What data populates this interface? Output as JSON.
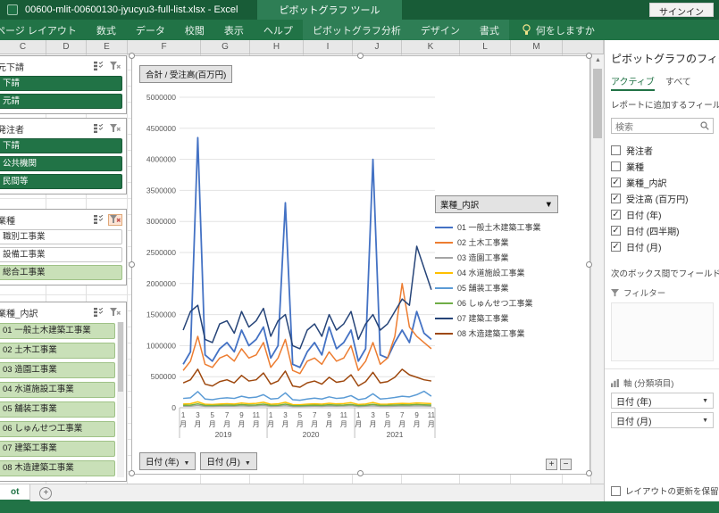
{
  "title_bar": {
    "filename": "00600-mlit-00600130-jyucyu3-full-list.xlsx  -  Excel",
    "context_label": "ピボットグラフ ツール",
    "sign_in": "サインイン"
  },
  "ribbon": {
    "tabs": [
      {
        "label": "ページ レイアウト",
        "contextual": false
      },
      {
        "label": "数式",
        "contextual": false
      },
      {
        "label": "データ",
        "contextual": false
      },
      {
        "label": "校閲",
        "contextual": false
      },
      {
        "label": "表示",
        "contextual": false
      },
      {
        "label": "ヘルプ",
        "contextual": false
      },
      {
        "label": "ピボットグラフ分析",
        "contextual": true
      },
      {
        "label": "デザイン",
        "contextual": true
      },
      {
        "label": "書式",
        "contextual": true
      }
    ],
    "tell_me": "何をしますか"
  },
  "column_headers": [
    "C",
    "D",
    "E",
    "F",
    "G",
    "H",
    "I",
    "J",
    "K",
    "L",
    "M"
  ],
  "slicers": [
    {
      "title": "元下請",
      "style": "dark",
      "filter_active": false,
      "scrollbar": false,
      "items": [
        {
          "label": "下請",
          "on": true
        },
        {
          "label": "元請",
          "on": true
        }
      ]
    },
    {
      "title": "発注者",
      "style": "dark",
      "filter_active": false,
      "scrollbar": false,
      "items": [
        {
          "label": "下請",
          "on": true
        },
        {
          "label": "公共機関",
          "on": true
        },
        {
          "label": "民間等",
          "on": true
        }
      ]
    },
    {
      "title": "業種",
      "style": "light",
      "filter_active": true,
      "scrollbar": false,
      "items": [
        {
          "label": "職別工事業",
          "on": false
        },
        {
          "label": "設備工事業",
          "on": false
        },
        {
          "label": "総合工事業",
          "on": true
        }
      ]
    },
    {
      "title": "業種_内訳",
      "style": "light",
      "filter_active": false,
      "scrollbar": true,
      "items": [
        {
          "label": "01 一般土木建築工事業",
          "on": true
        },
        {
          "label": "02 土木工事業",
          "on": true
        },
        {
          "label": "03 造園工事業",
          "on": true
        },
        {
          "label": "04 水道施設工事業",
          "on": true
        },
        {
          "label": "05 舗装工事業",
          "on": true
        },
        {
          "label": "06 しゅんせつ工事業",
          "on": true
        },
        {
          "label": "07 建築工事業",
          "on": true
        },
        {
          "label": "08 木造建築工事業",
          "on": true
        }
      ]
    }
  ],
  "chart_data": {
    "type": "line",
    "title": "合計 / 受注高(百万円)",
    "legend_title": "業種_内訳",
    "ylim": [
      0,
      5000000
    ],
    "y_tick_step": 500000,
    "month_suffix": "月",
    "x_tick_months": [
      1,
      3,
      5,
      7,
      9,
      11
    ],
    "years": [
      {
        "year": "2019",
        "months": 12
      },
      {
        "year": "2020",
        "months": 12
      },
      {
        "year": "2021",
        "months": 11
      }
    ],
    "x_month_count": 35,
    "series": [
      {
        "name": "01 一般土木建築工事業",
        "color": "#4472C4",
        "values": [
          700000,
          900000,
          4350000,
          850000,
          750000,
          950000,
          1050000,
          900000,
          1250000,
          1000000,
          1100000,
          1300000,
          800000,
          1000000,
          3300000,
          700000,
          650000,
          900000,
          1050000,
          850000,
          1300000,
          950000,
          1050000,
          1250000,
          750000,
          950000,
          4000000,
          850000,
          800000,
          1050000,
          1250000,
          1050000,
          1550000,
          1200000,
          1100000
        ]
      },
      {
        "name": "02 土木工事業",
        "color": "#ED7D31",
        "values": [
          600000,
          750000,
          1150000,
          700000,
          650000,
          800000,
          850000,
          750000,
          950000,
          800000,
          850000,
          1050000,
          650000,
          800000,
          1100000,
          600000,
          550000,
          750000,
          800000,
          700000,
          900000,
          750000,
          800000,
          1000000,
          600000,
          750000,
          1050000,
          700000,
          800000,
          1150000,
          2000000,
          1300000,
          1150000,
          1050000,
          950000
        ]
      },
      {
        "name": "03 造園工事業",
        "color": "#A5A5A5",
        "values": [
          25000,
          26000,
          36000,
          24000,
          23000,
          25000,
          26000,
          25000,
          30000,
          26000,
          28000,
          34000,
          24000,
          25000,
          33000,
          22000,
          21000,
          24000,
          25000,
          24000,
          29000,
          25000,
          27000,
          32000,
          22000,
          25000,
          31000,
          24000,
          24000,
          26000,
          28000,
          27000,
          31000,
          28000,
          26000
        ]
      },
      {
        "name": "04 水道施設工事業",
        "color": "#FFC000",
        "values": [
          60000,
          65000,
          95000,
          55000,
          52000,
          60000,
          65000,
          60000,
          76000,
          65000,
          70000,
          88000,
          56000,
          62000,
          88000,
          50000,
          48000,
          58000,
          62000,
          58000,
          72000,
          62000,
          66000,
          82000,
          52000,
          60000,
          84000,
          56000,
          58000,
          64000,
          70000,
          66000,
          78000,
          72000,
          66000
        ]
      },
      {
        "name": "05 舗装工事業",
        "color": "#5B9BD5",
        "values": [
          150000,
          160000,
          260000,
          140000,
          130000,
          150000,
          160000,
          150000,
          185000,
          160000,
          170000,
          210000,
          140000,
          150000,
          240000,
          130000,
          120000,
          140000,
          155000,
          140000,
          175000,
          150000,
          160000,
          195000,
          130000,
          150000,
          225000,
          140000,
          150000,
          165000,
          185000,
          175000,
          210000,
          265000,
          185000
        ]
      },
      {
        "name": "06 しゅんせつ工事業",
        "color": "#70AD47",
        "values": [
          40000,
          42000,
          62000,
          38000,
          36000,
          40000,
          43000,
          40000,
          50000,
          43000,
          45000,
          57000,
          38000,
          40000,
          57000,
          35000,
          33000,
          38000,
          41000,
          38000,
          48000,
          41000,
          43000,
          52000,
          35000,
          40000,
          54000,
          38000,
          39000,
          43000,
          47000,
          45000,
          52000,
          47000,
          43000
        ]
      },
      {
        "name": "07 建築工事業",
        "color": "#264478",
        "values": [
          1250000,
          1550000,
          1650000,
          1100000,
          1050000,
          1350000,
          1400000,
          1200000,
          1550000,
          1300000,
          1400000,
          1600000,
          1150000,
          1400000,
          1500000,
          1000000,
          950000,
          1250000,
          1350000,
          1150000,
          1500000,
          1250000,
          1350000,
          1550000,
          1100000,
          1350000,
          1500000,
          1250000,
          1350000,
          1550000,
          1750000,
          1650000,
          2600000,
          2250000,
          1900000
        ]
      },
      {
        "name": "08 木造建築工事業",
        "color": "#9E480E",
        "values": [
          400000,
          450000,
          620000,
          380000,
          350000,
          420000,
          450000,
          400000,
          520000,
          430000,
          450000,
          560000,
          380000,
          430000,
          590000,
          350000,
          330000,
          400000,
          430000,
          380000,
          490000,
          410000,
          430000,
          530000,
          350000,
          420000,
          570000,
          400000,
          420000,
          490000,
          620000,
          530000,
          490000,
          450000,
          430000
        ]
      }
    ]
  },
  "chart_ui": {
    "axis_year_button": "日付 (年)",
    "axis_month_button": "日付 (月)",
    "expand": "+",
    "collapse": "−"
  },
  "fields_pane": {
    "title": "ピボットグラフのフィールド",
    "tabs": [
      {
        "label": "アクティブ",
        "active": true
      },
      {
        "label": "すべて",
        "active": false
      }
    ],
    "hint": "レポートに追加するフィールドを選択してください:",
    "search_placeholder": "検索",
    "fields": [
      {
        "label": "発注者",
        "checked": false
      },
      {
        "label": "業種",
        "checked": false
      },
      {
        "label": "業種_内訳",
        "checked": true
      },
      {
        "label": "受注高 (百万円)",
        "checked": true
      },
      {
        "label": "日付 (年)",
        "checked": true
      },
      {
        "label": "日付 (四半期)",
        "checked": true
      },
      {
        "label": "日付 (月)",
        "checked": true
      }
    ],
    "drag_hint": "次のボックス間でフィールドをドラッグしてください:",
    "areas": {
      "filter_label": "フィルター",
      "axis_label": "軸 (分類項目)",
      "axis_items": [
        "日付 (年)",
        "日付 (月)"
      ]
    },
    "defer_label": "レイアウトの更新を保留する"
  },
  "sheet_bar": {
    "active_tab": "ot",
    "add": "+"
  }
}
